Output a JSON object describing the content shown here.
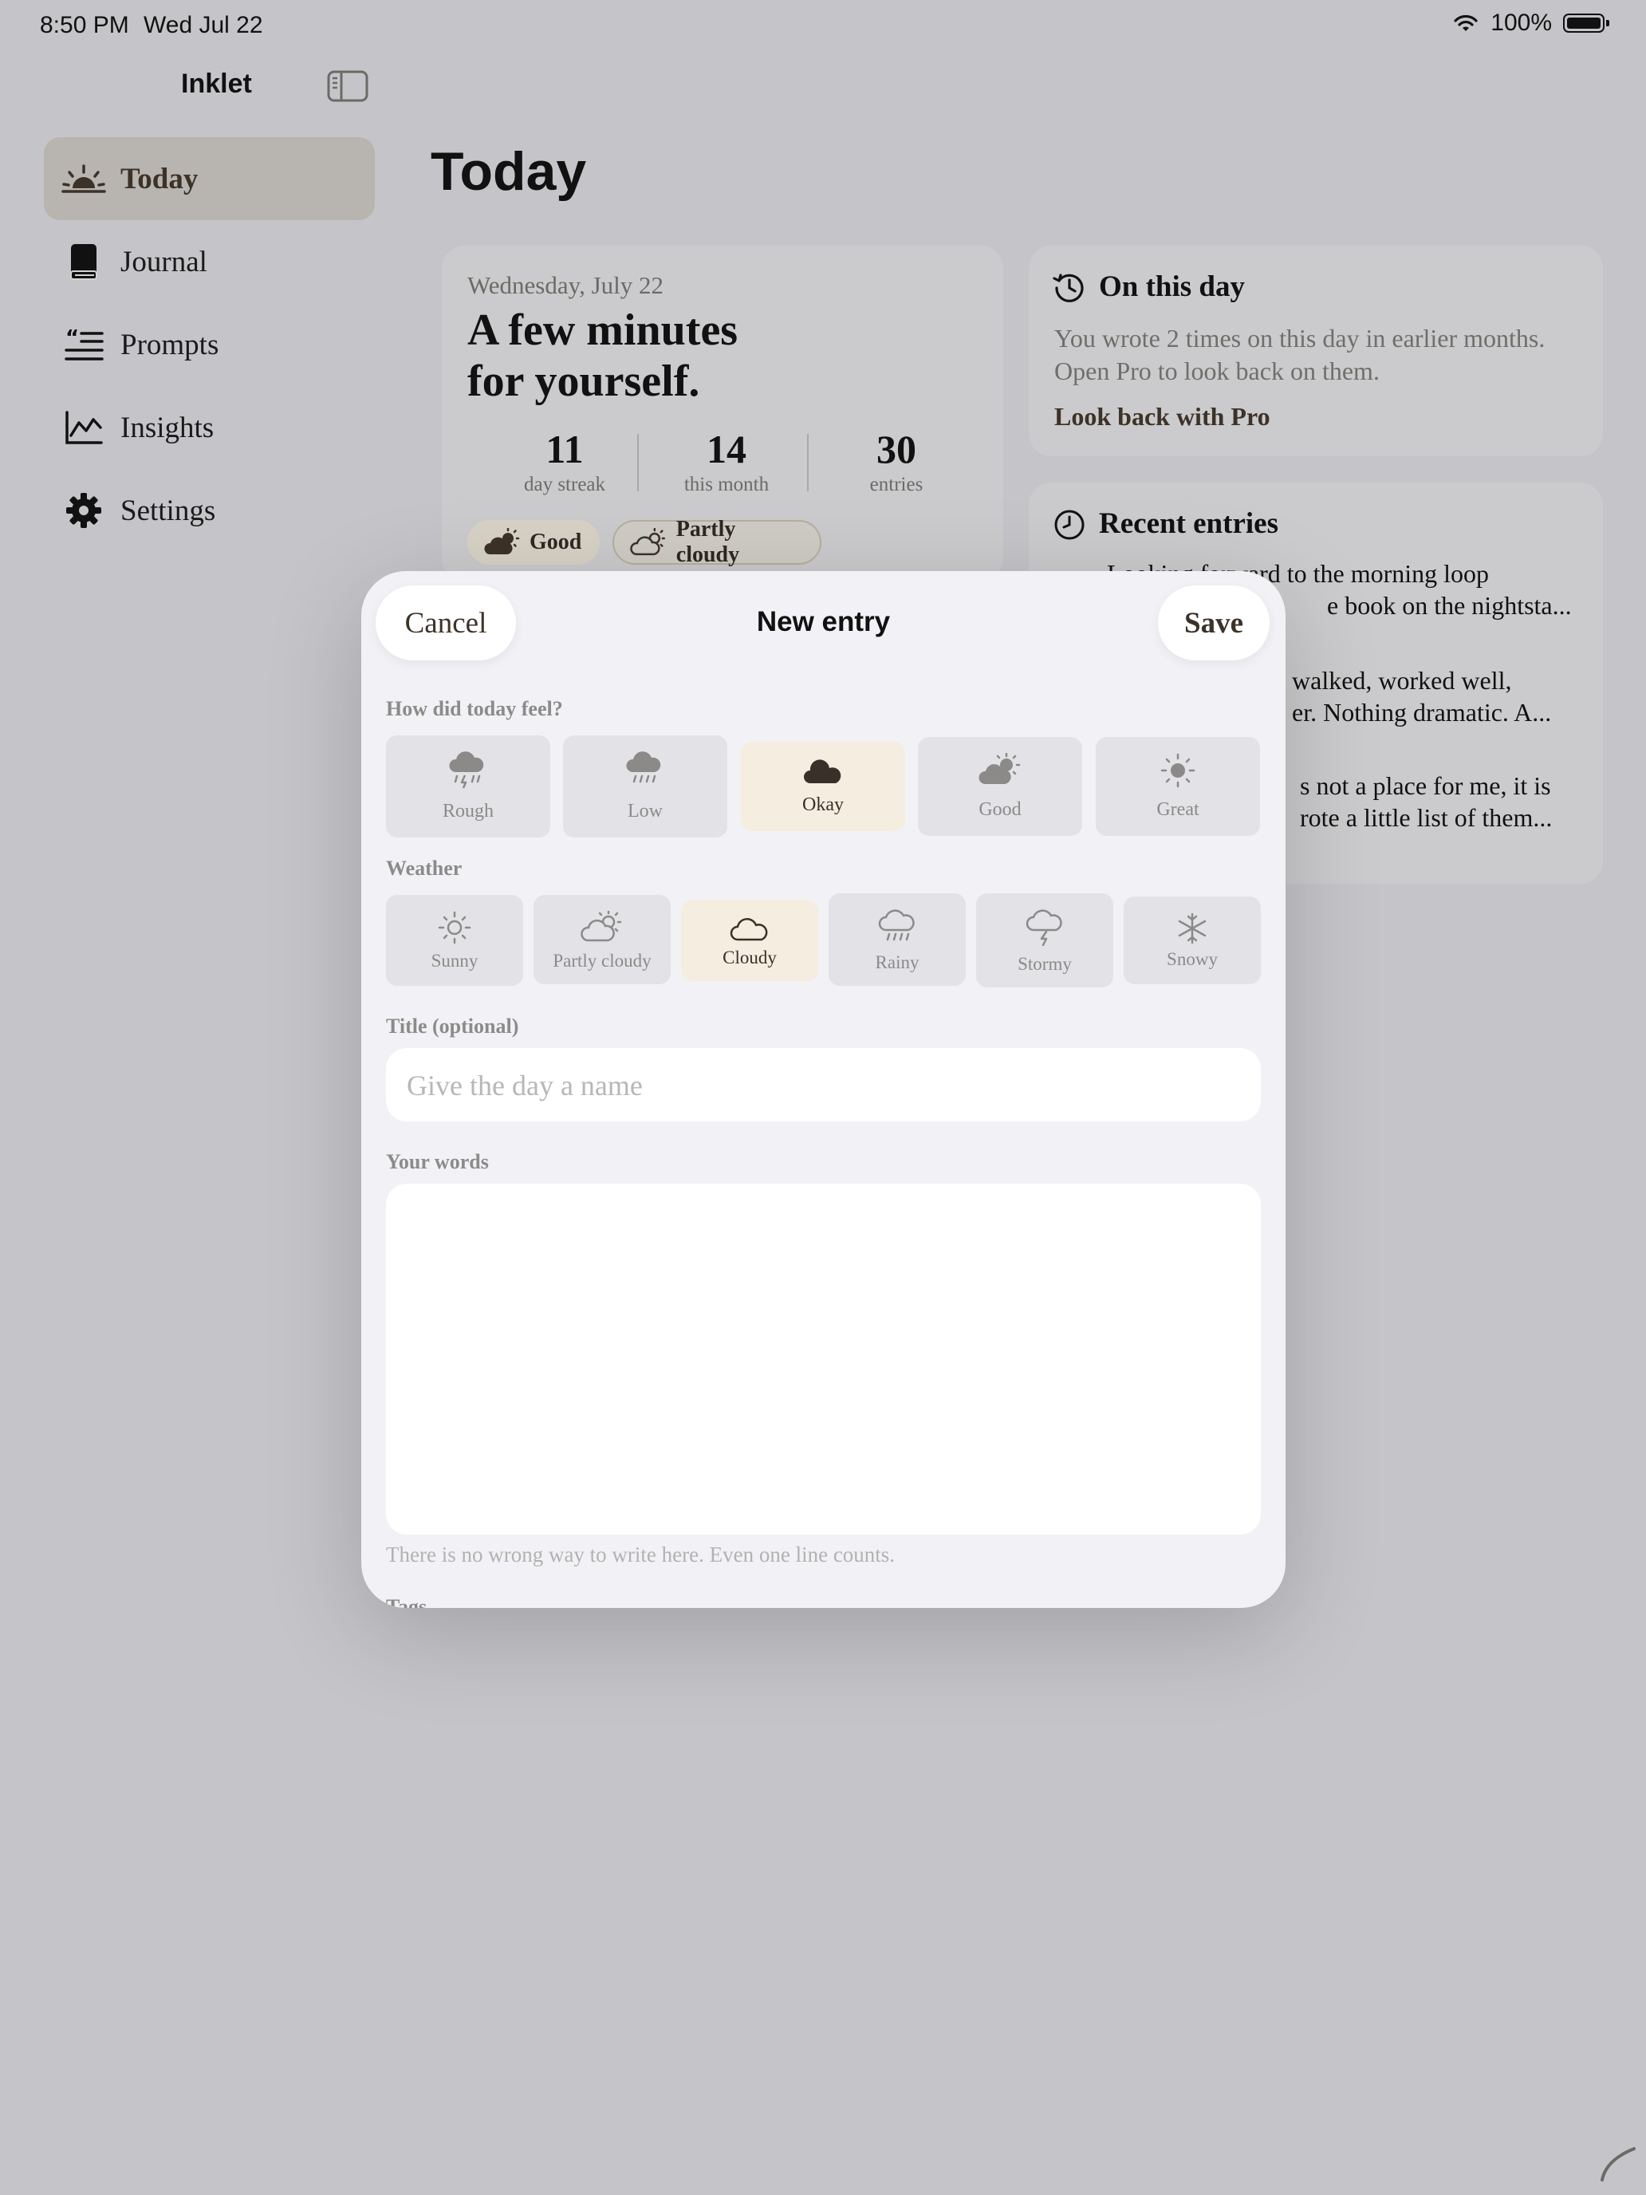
{
  "status": {
    "time": "8:50 PM",
    "date": "Wed Jul 22",
    "battery": "100%",
    "battery_level": 1.0
  },
  "app": {
    "title": "Inklet"
  },
  "sidebar": {
    "items": [
      {
        "label": "Today",
        "icon": "sunrise-icon",
        "active": true
      },
      {
        "label": "Journal",
        "icon": "book-icon"
      },
      {
        "label": "Prompts",
        "icon": "quote-list-icon"
      },
      {
        "label": "Insights",
        "icon": "chart-icon"
      },
      {
        "label": "Settings",
        "icon": "gear-icon"
      }
    ]
  },
  "main": {
    "title": "Today",
    "hero": {
      "date": "Wednesday, July 22",
      "headline_1": "A few minutes",
      "headline_2": "for yourself.",
      "stats": [
        {
          "value": "11",
          "label": "day streak"
        },
        {
          "value": "14",
          "label": "this month"
        },
        {
          "value": "30",
          "label": "entries"
        }
      ],
      "mood_pill": "Good",
      "weather_pill": "Partly cloudy"
    },
    "on_this_day": {
      "title": "On this day",
      "text": "You wrote 2 times on this day in earlier months. Open Pro to look back on them.",
      "link": "Look back with Pro"
    },
    "recent": {
      "title": "Recent entries",
      "lines": [
        "Looking forward to the morning loop",
        "e book on the nightsta...",
        "walked, worked well,",
        "er. Nothing dramatic. A...",
        "s not a place for me, it is",
        "rote a little list of them..."
      ]
    }
  },
  "modal": {
    "title": "New entry",
    "cancel": "Cancel",
    "save": "Save",
    "mood_label": "How did today feel?",
    "moods": [
      {
        "label": "Rough",
        "icon": "cloud-bolt-rain-icon"
      },
      {
        "label": "Low",
        "icon": "cloud-rain-icon"
      },
      {
        "label": "Okay",
        "icon": "cloud-filled-icon",
        "selected": true
      },
      {
        "label": "Good",
        "icon": "cloud-sun-filled-icon"
      },
      {
        "label": "Great",
        "icon": "sun-filled-icon"
      }
    ],
    "weather_label": "Weather",
    "weather": [
      {
        "label": "Sunny",
        "icon": "sun-icon"
      },
      {
        "label": "Partly cloudy",
        "icon": "cloud-sun-icon"
      },
      {
        "label": "Cloudy",
        "icon": "cloud-icon",
        "selected": true
      },
      {
        "label": "Rainy",
        "icon": "cloud-rain-outline-icon"
      },
      {
        "label": "Stormy",
        "icon": "cloud-bolt-icon"
      },
      {
        "label": "Snowy",
        "icon": "snowflake-icon"
      }
    ],
    "title_label": "Title (optional)",
    "title_placeholder": "Give the day a name",
    "title_value": "",
    "words_label": "Your words",
    "words_value": "",
    "hint": "There is no wrong way to write here. Even one line counts.",
    "next_section_partial": "Tags"
  },
  "colors": {
    "accent": "#3d3228",
    "selected_bg": "#f4ede0",
    "sheet_bg": "#f2f1f5",
    "dim_bg": "#c5c5c9"
  }
}
